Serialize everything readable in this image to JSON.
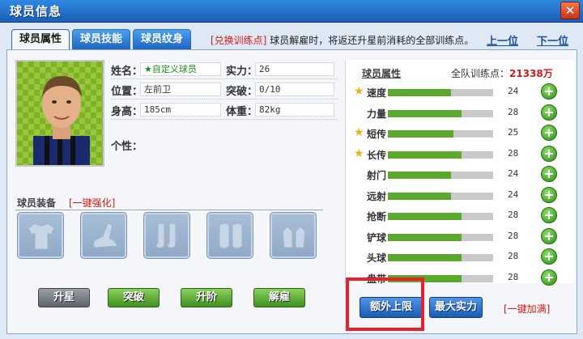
{
  "window": {
    "title": "球员信息",
    "close_label": "✕"
  },
  "tabs": [
    {
      "label": "球员属性",
      "active": true
    },
    {
      "label": "球员技能",
      "active": false
    },
    {
      "label": "球员纹身",
      "active": false
    }
  ],
  "notice": {
    "link": "[兑换训练点]",
    "text": "球员解雇时，将返还升星前消耗的全部训练点。"
  },
  "nav": {
    "prev": "上一位",
    "next": "下一位"
  },
  "player": {
    "name_label": "姓名：",
    "name": "★自定义球员",
    "strength_label": "实力：",
    "strength": "26",
    "position_label": "位置：",
    "position": "左前卫",
    "breakthrough_label": "突破：",
    "breakthrough": "0/10",
    "height_label": "身高：",
    "height": "185cm",
    "weight_label": "体重：",
    "weight": "82kg",
    "trait_label": "个性："
  },
  "equipment": {
    "title": "球员装备",
    "enhance_link": "[一键强化]",
    "slots": [
      "jersey-icon",
      "boot-icon",
      "sock-icon",
      "shin-guard-icon",
      "glove-icon"
    ]
  },
  "actions": {
    "star_up": "升星",
    "breakthrough": "突破",
    "rank_up": "升阶",
    "dismiss": "解雇"
  },
  "attributes": {
    "title": "球员属性",
    "team_points_label": "全队训练点：",
    "team_points": "21338万",
    "max_value": 100,
    "items": [
      {
        "name": "速度",
        "value": 24,
        "star": true
      },
      {
        "name": "力量",
        "value": 28,
        "star": false
      },
      {
        "name": "短传",
        "value": 25,
        "star": true
      },
      {
        "name": "长传",
        "value": 28,
        "star": true
      },
      {
        "name": "射门",
        "value": 24,
        "star": false
      },
      {
        "name": "远射",
        "value": 24,
        "star": false
      },
      {
        "name": "抢断",
        "value": 28,
        "star": false
      },
      {
        "name": "铲球",
        "value": 28,
        "star": false
      },
      {
        "name": "头球",
        "value": 28,
        "star": false
      },
      {
        "name": "盘带",
        "value": 28,
        "star": false
      }
    ],
    "extra_cap_button": "额外上限",
    "max_strength_button": "最大实力",
    "onekey_max": "[一键加满]"
  },
  "colors": {
    "highlight": "#e8202a",
    "bar_fill": "#5aa82c",
    "link_red": "#d11a1a"
  }
}
